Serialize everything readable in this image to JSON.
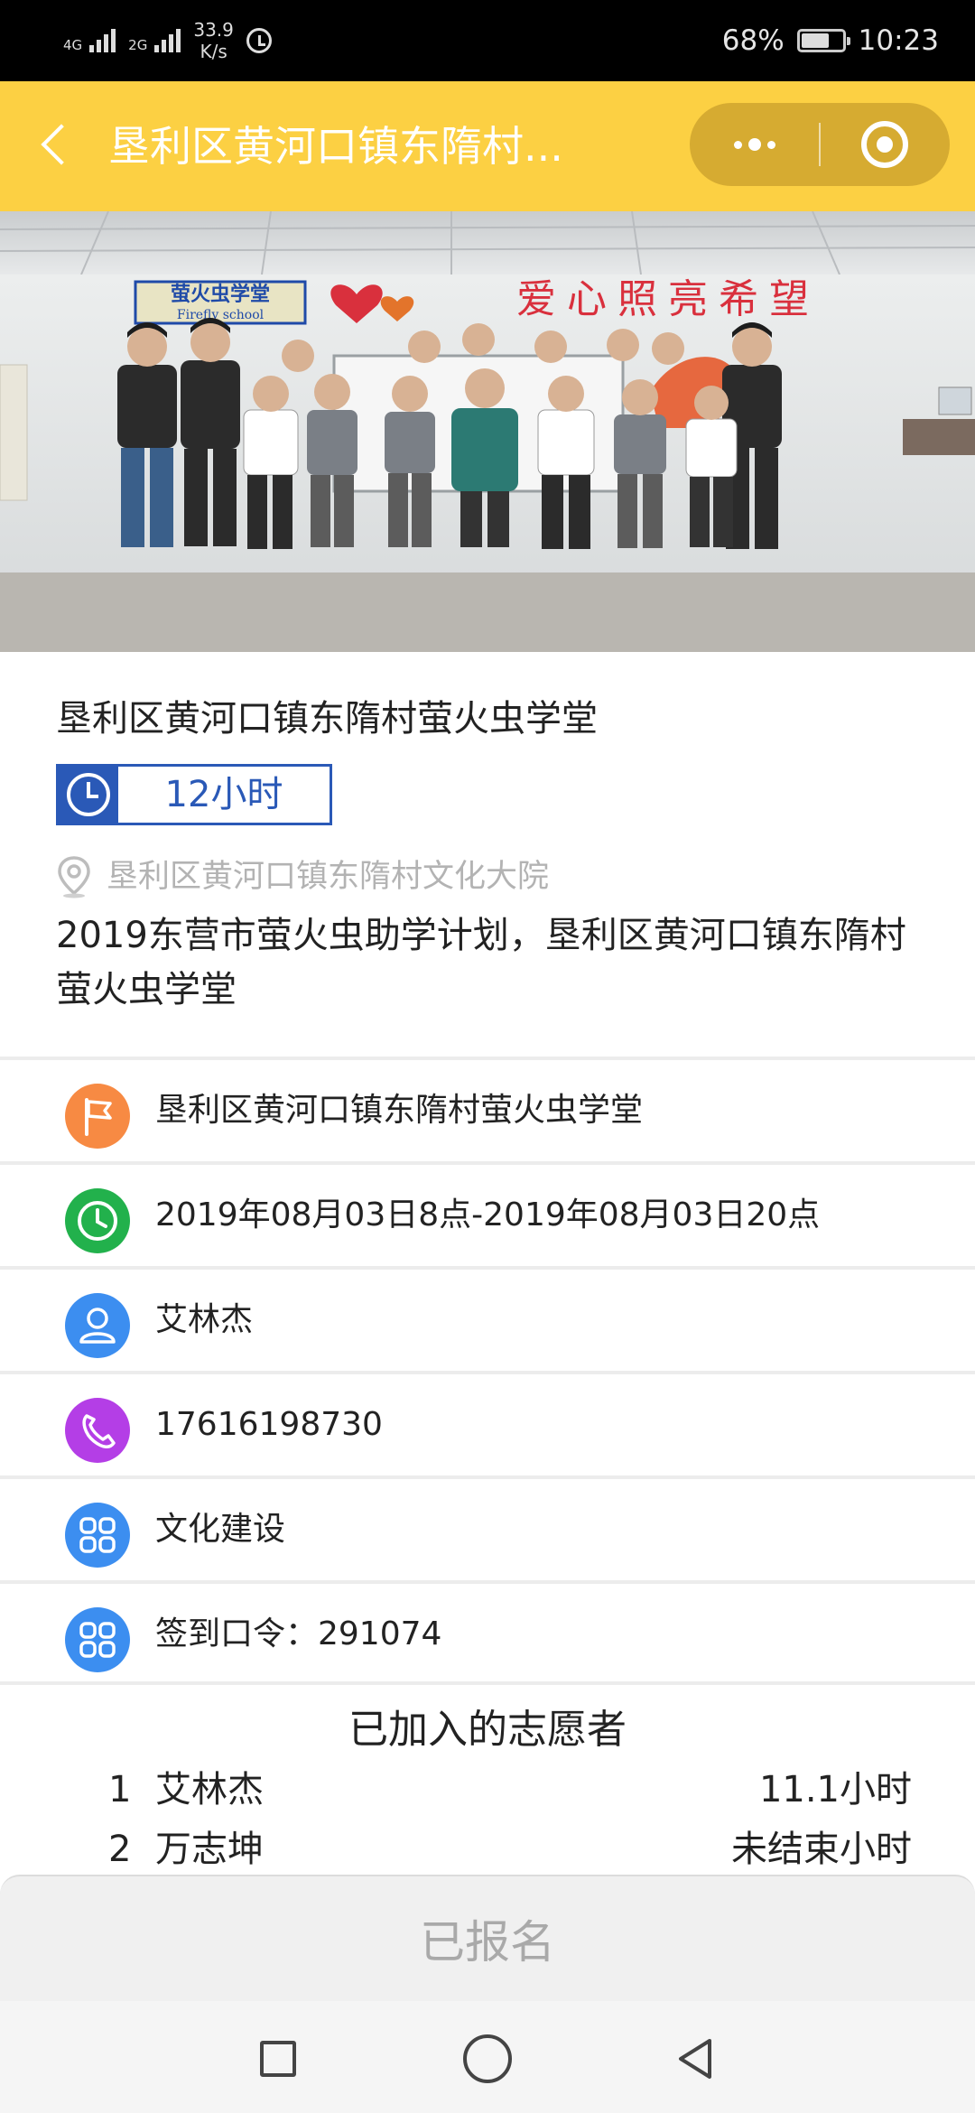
{
  "status_bar": {
    "net1": "4G",
    "net2": "2G",
    "speed_value": "33.9",
    "speed_unit": "K/s",
    "battery_percent": "68%",
    "battery_level": 0.68,
    "time": "10:23"
  },
  "nav": {
    "title": "垦利区黄河口镇东隋村..."
  },
  "photo": {
    "sign_cn": "萤火虫学堂",
    "sign_en": "Firefly school",
    "slogan": "爱心照亮希望"
  },
  "activity": {
    "title": "垦利区黄河口镇东隋村萤火虫学堂",
    "hours": "12小时",
    "location": "垦利区黄河口镇东隋村文化大院",
    "description": "2019东营市萤火虫助学计划，垦利区黄河口镇东隋村萤火虫学堂"
  },
  "details": {
    "organizer": "垦利区黄河口镇东隋村萤火虫学堂",
    "time_range": "2019年08月03日8点-2019年08月03日20点",
    "contact_name": "艾林杰",
    "phone": "17616198730",
    "category": "文化建设",
    "checkin_code": "签到口令：291074"
  },
  "volunteers": {
    "heading": "已加入的志愿者",
    "list": [
      {
        "no": "1",
        "name": "艾林杰",
        "hours": "11.1小时"
      },
      {
        "no": "2",
        "name": "万志坤",
        "hours": "未结束小时"
      }
    ]
  },
  "footer": {
    "signup_label": "已报名"
  },
  "colors": {
    "nav_yellow": "#fcd043",
    "badge_blue": "#2a59b7",
    "icon_orange": "#f78a43",
    "icon_green": "#22b14c",
    "icon_blue": "#3c8ef0",
    "icon_purple": "#b43ee6"
  }
}
